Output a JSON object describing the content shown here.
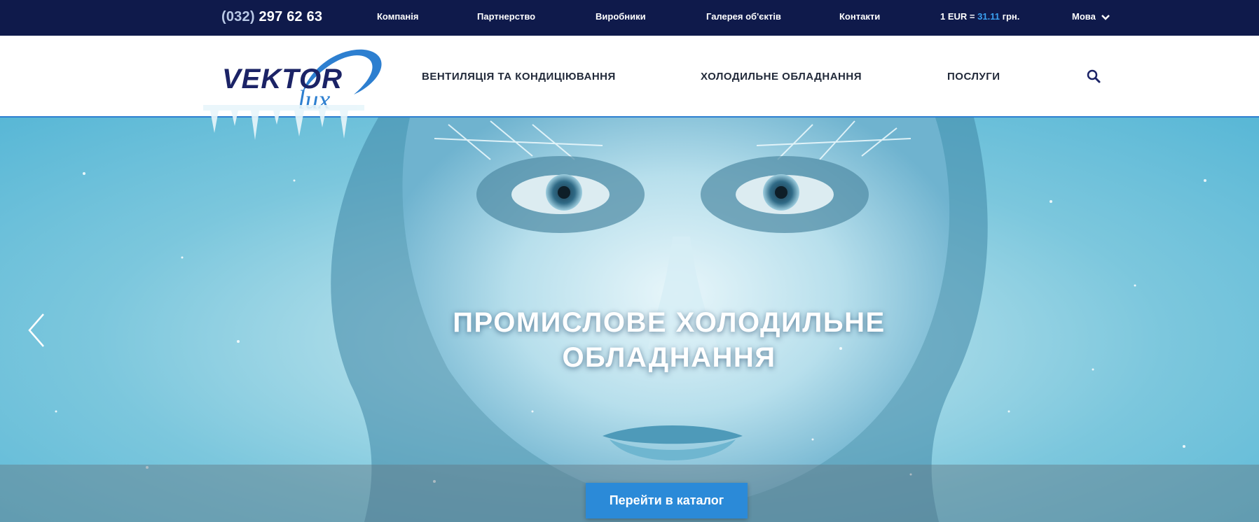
{
  "topbar": {
    "phone_code": "(032)",
    "phone_number": "297 62 63",
    "links": [
      "Компанія",
      "Партнерство",
      "Виробники",
      "Галерея об'єктів",
      "Контакти"
    ],
    "rate_prefix": "1 EUR =",
    "rate_value": "31.11",
    "rate_suffix": "грн.",
    "lang_label": "Мова"
  },
  "header": {
    "logo_word": "VEKTOR",
    "logo_script": "lux",
    "nav": [
      "ВЕНТИЛЯЦІЯ ТА КОНДИЦІЮВАННЯ",
      "ХОЛОДИЛЬНЕ ОБЛАДНАННЯ",
      "ПОСЛУГИ"
    ],
    "search_icon": "search-icon"
  },
  "hero": {
    "title_line1": "ПРОМИСЛОВЕ ХОЛОДИЛЬНЕ",
    "title_line2": "ОБЛАДНАННЯ",
    "cta_label": "Перейти в каталог",
    "prev_icon": "chevron-left-icon"
  },
  "colors": {
    "topbar_bg": "#0f1a4b",
    "accent": "#2b8ad8",
    "logo_dark": "#1b2366"
  }
}
